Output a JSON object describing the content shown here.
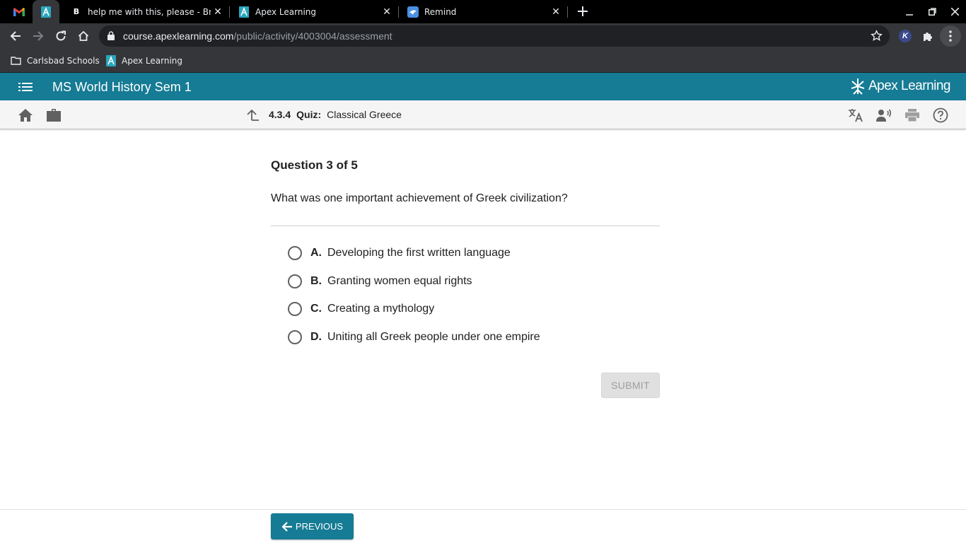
{
  "browser": {
    "pinned_tabs": [
      {
        "icon": "gmail-icon"
      },
      {
        "icon": "apex-learning-icon",
        "active": true
      }
    ],
    "tabs": [
      {
        "title": "help me with this, please - Brainl",
        "icon": "brainly-icon"
      },
      {
        "title": "Apex Learning",
        "icon": "apex-learning-icon"
      },
      {
        "title": "Remind",
        "icon": "remind-icon"
      }
    ],
    "url": {
      "host": "course.apexlearning.com",
      "path": "/public/activity/4003004/assessment"
    },
    "bookmarks": [
      {
        "label": "Carlsbad Schools",
        "icon": "folder-icon"
      },
      {
        "label": "Apex Learning",
        "icon": "apex-learning-icon"
      }
    ],
    "profile_initial": "K"
  },
  "app": {
    "course_title": "MS World History Sem 1",
    "brand": "Apex Learning",
    "accent_color": "#167b94",
    "breadcrumb": {
      "number": "4.3.4",
      "type": "Quiz:",
      "name": "Classical Greece"
    }
  },
  "quiz": {
    "counter": "Question 3 of 5",
    "question": "What was one important achievement of Greek civilization?",
    "choices": [
      {
        "letter": "A.",
        "text": "Developing the first written language"
      },
      {
        "letter": "B.",
        "text": "Granting women equal rights"
      },
      {
        "letter": "C.",
        "text": "Creating a mythology"
      },
      {
        "letter": "D.",
        "text": "Uniting all Greek people under one empire"
      }
    ],
    "submit_label": "SUBMIT",
    "previous_label": "PREVIOUS"
  }
}
